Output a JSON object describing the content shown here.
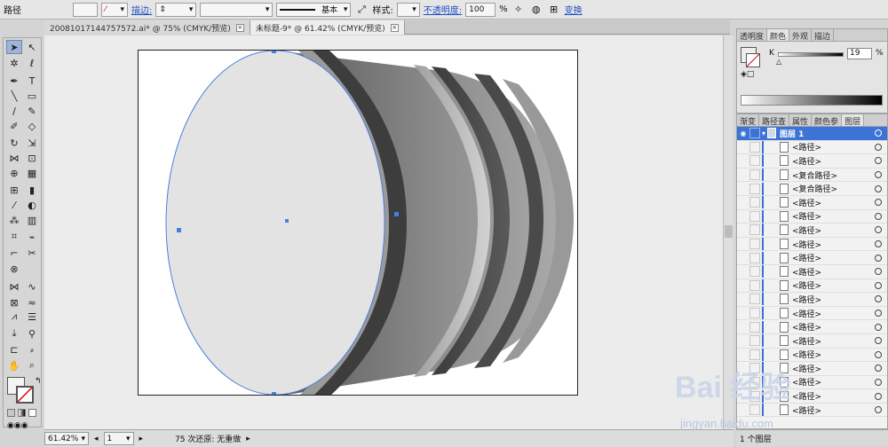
{
  "control_bar": {
    "path_label": "路径",
    "stroke_label": "描边:",
    "stroke_value": "",
    "brush_value": "基本",
    "style_label": "样式:",
    "opacity_label": "不透明度:",
    "opacity_value": "100",
    "opacity_unit": "%",
    "transform_label": "变换"
  },
  "doc_tabs": [
    {
      "label": "20081017144757572.ai* @ 75% (CMYK/预览)",
      "active": false
    },
    {
      "label": "未标题-9* @ 61.42% (CMYK/预览)",
      "active": true
    }
  ],
  "status_bar": {
    "zoom": "61.42%",
    "page": "1",
    "undo_status": "75 次还原: 无重做"
  },
  "color_panel": {
    "tabs": [
      "透明度",
      "颜色",
      "外观",
      "描边"
    ],
    "k_label": "K",
    "k_value": "19",
    "k_unit": "%"
  },
  "layers_panel": {
    "tabs": [
      "渐变",
      "路径查",
      "属性",
      "颜色参",
      "图层"
    ],
    "layer_name": "图层 1",
    "items": [
      "<路径>",
      "<路径>",
      "<复合路径>",
      "<复合路径>",
      "<路径>",
      "<路径>",
      "<路径>",
      "<路径>",
      "<路径>",
      "<路径>",
      "<路径>",
      "<路径>",
      "<路径>",
      "<路径>",
      "<路径>",
      "<路径>",
      "<路径>",
      "<路径>",
      "<路径>",
      "<路径>"
    ],
    "footer": "1 个图层"
  },
  "watermark": {
    "text": "Bai 经验",
    "url": "jingyan.baidu.com"
  },
  "colors": {
    "accent": "#3b73d6",
    "link": "#1f4fc4",
    "selection": "#4a7de0"
  }
}
